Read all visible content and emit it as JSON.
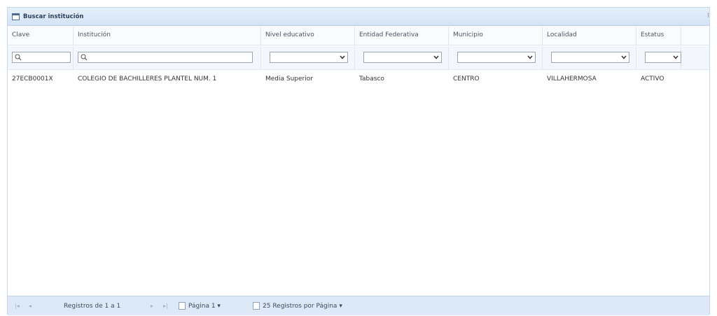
{
  "panel": {
    "title": "Buscar institución"
  },
  "columns": [
    "Clave",
    "Institución",
    "Nivel educativo",
    "Entidad Federativa",
    "Municipio",
    "Localidad",
    "Estatus"
  ],
  "rows": [
    [
      "27ECB0001X",
      "COLEGIO DE BACHILLERES PLANTEL NUM. 1",
      "Media Superior",
      "Tabasco",
      "CENTRO",
      "VILLAHERMOSA",
      "ACTIVO"
    ]
  ],
  "pager": {
    "records": "Registros de 1 a 1",
    "page": "Página 1",
    "per_page": "25 Registros por Página"
  }
}
